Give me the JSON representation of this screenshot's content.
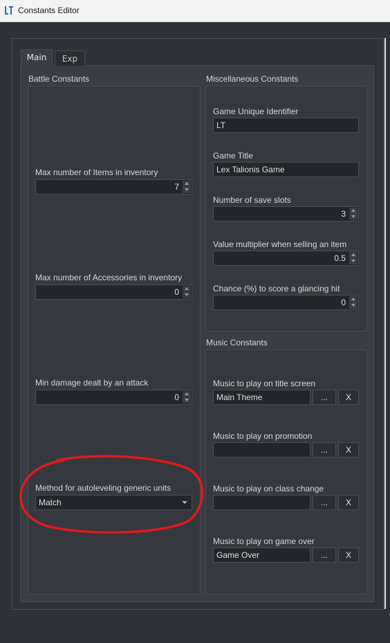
{
  "window": {
    "title": "Constants Editor",
    "logo_text": "LT"
  },
  "tabs": [
    {
      "label": "Main",
      "active": true
    },
    {
      "label": "Exp",
      "active": false
    }
  ],
  "battle": {
    "title": "Battle Constants",
    "max_items": {
      "label": "Max number of Items in inventory",
      "value": "7"
    },
    "max_accessories": {
      "label": "Max number of Accessories in inventory",
      "value": "0"
    },
    "min_damage": {
      "label": "Min damage dealt by an attack",
      "value": "0"
    },
    "autolevel": {
      "label": "Method for autoleveling generic units",
      "value": "Match"
    }
  },
  "misc": {
    "title": "Miscellaneous Constants",
    "game_id": {
      "label": "Game Unique Identifier",
      "value": "LT"
    },
    "game_title": {
      "label": "Game Title",
      "value": "Lex Talionis Game"
    },
    "save_slots": {
      "label": "Number of save slots",
      "value": "3"
    },
    "sell_multiplier": {
      "label": "Value multiplier when selling an item",
      "value": "0.5"
    },
    "glancing_hit": {
      "label": "Chance (%) to score a glancing hit",
      "value": "0"
    }
  },
  "music": {
    "title": "Music Constants",
    "browse_label": "...",
    "clear_label": "X",
    "title_screen": {
      "label": "Music to play on title screen",
      "value": "Main Theme"
    },
    "promotion": {
      "label": "Music to play on promotion",
      "value": ""
    },
    "class_change": {
      "label": "Music to play on class change",
      "value": ""
    },
    "game_over": {
      "label": "Music to play on game over",
      "value": "Game Over"
    }
  },
  "annotation_color": "#e01b1b"
}
